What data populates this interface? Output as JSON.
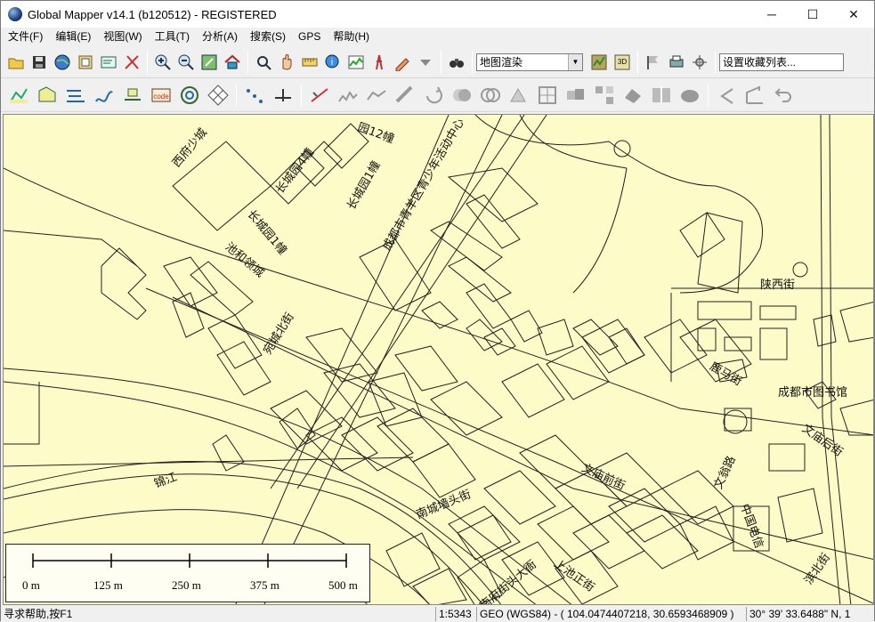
{
  "window": {
    "title": "Global Mapper v14.1 (b120512) - REGISTERED",
    "controls": {
      "minimize": "─",
      "maximize": "☐",
      "close": "✕"
    }
  },
  "menu": [
    "文件(F)",
    "编辑(E)",
    "视图(W)",
    "工具(T)",
    "分析(A)",
    "搜索(S)",
    "GPS",
    "帮助(H)"
  ],
  "toolbar": {
    "render_combo": "地图渲染",
    "favorites_combo": "设置收藏列表..."
  },
  "map": {
    "labels": {
      "xifu": "西府少城",
      "changcheng4": "长城园4幢",
      "changcheng1": "长城园1幢",
      "yuan12": "园12幢",
      "qingyang_youth": "成都市青羊区青少年活动中心",
      "chengyuan1": "长城园1幢",
      "chihe": "池和领城",
      "wancheng": "宛城北街",
      "shaanxi": "陕西街",
      "library": "成都市图书馆",
      "wenmiao_back": "文庙后街",
      "wenmiao_front": "文庙前街",
      "wenweng": "文翁路",
      "nancheng": "南城墙头街",
      "jinjiang": "锦江",
      "zhongguo": "中国电信",
      "shangxiang": "上池正街",
      "hebin": "河滨街",
      "danbei": "滨北街",
      "nanshi": "南府街头大衙",
      "luma": "鹿马街"
    }
  },
  "scale": {
    "labels": [
      "0 m",
      "125 m",
      "250 m",
      "375 m",
      "500 m"
    ]
  },
  "status": {
    "help": "寻求帮助,按F1",
    "scale": "1:5343",
    "coords": "GEO (WGS84) - ( 104.0474407218, 30.6593468909 )",
    "dms": "30° 39' 33.6488\" N, 1"
  }
}
